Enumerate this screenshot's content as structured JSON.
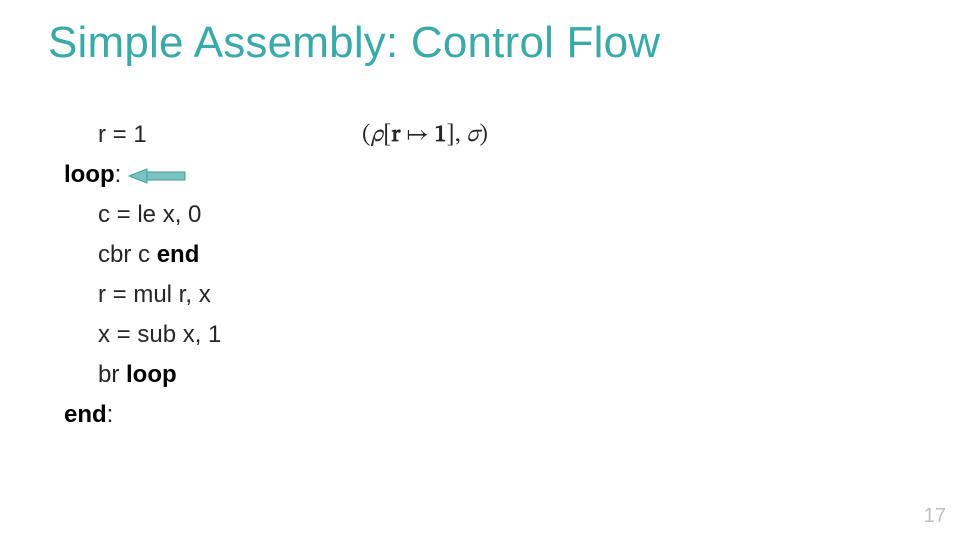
{
  "title": "Simple Assembly: Control Flow",
  "code": {
    "r1": "r = 1",
    "loop_label": "loop",
    "colon": ":",
    "c_le": "c = le x, 0",
    "cbr": "cbr c ",
    "cbr_target": "end",
    "r_mul": "r = mul r, x",
    "x_sub": "x = sub x, 1",
    "br": "br ",
    "br_target": "loop",
    "end_label": "end"
  },
  "semantics": {
    "open": "(",
    "rho": "ρ",
    "lbr": "[",
    "r": "r",
    "maps": " ↦ ",
    "one": "1",
    "rbr": "]",
    "comma": ", ",
    "sigma": "σ",
    "close": ")"
  },
  "page_number": "17"
}
